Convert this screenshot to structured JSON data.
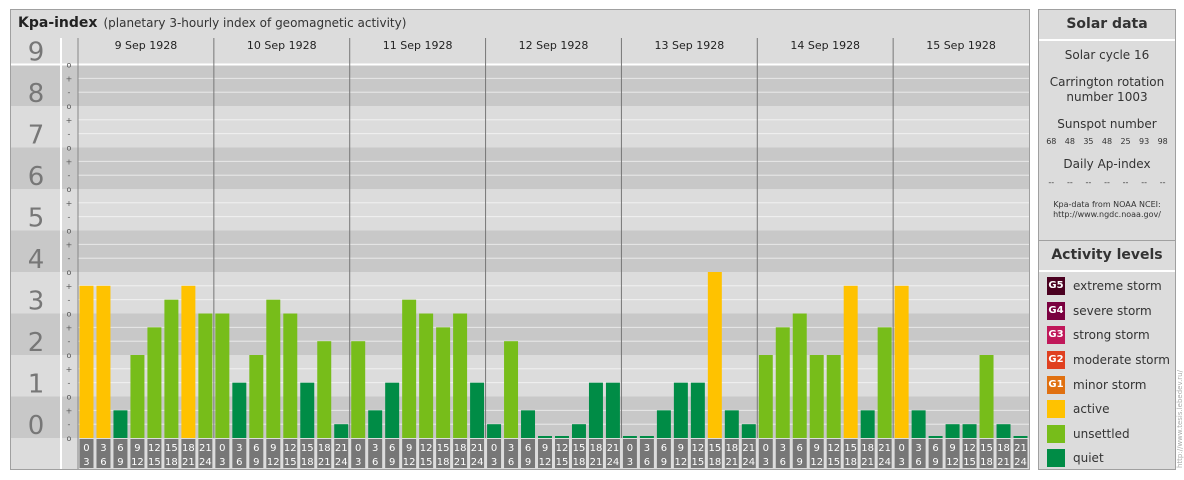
{
  "header": {
    "title": "Kpa-index",
    "subtitle": "(planetary 3-hourly index of geomagnetic activity)"
  },
  "chart_data": {
    "type": "bar",
    "title": "Kpa-index",
    "subtitle": "(planetary 3-hourly index of geomagnetic activity)",
    "ylim": [
      0,
      9
    ],
    "y_ticks": [
      "0",
      "1",
      "2",
      "3",
      "4",
      "5",
      "6",
      "7",
      "8",
      "9"
    ],
    "sub_tick_labels": [
      "+",
      "o",
      "-"
    ],
    "days": [
      "9 Sep 1928",
      "10 Sep 1928",
      "11 Sep 1928",
      "12 Sep 1928",
      "13 Sep 1928",
      "14 Sep 1928",
      "15 Sep 1928"
    ],
    "interval_labels": [
      [
        "0",
        "3"
      ],
      [
        "3",
        "6"
      ],
      [
        "6",
        "9"
      ],
      [
        "9",
        "12"
      ],
      [
        "12",
        "15"
      ],
      [
        "15",
        "18"
      ],
      [
        "18",
        "21"
      ],
      [
        "21",
        "24"
      ]
    ],
    "values": [
      [
        3.667,
        3.667,
        0.667,
        2.0,
        2.667,
        3.333,
        3.667,
        3.0
      ],
      [
        3.0,
        1.333,
        2.0,
        3.333,
        3.0,
        1.333,
        2.333,
        0.333
      ],
      [
        2.333,
        0.667,
        1.333,
        3.333,
        3.0,
        2.667,
        3.0,
        1.333
      ],
      [
        0.333,
        2.333,
        0.667,
        0.0,
        0.0,
        0.333,
        1.333,
        1.333
      ],
      [
        0.0,
        0.0,
        0.667,
        1.333,
        1.333,
        4.0,
        0.667,
        0.333
      ],
      [
        2.0,
        2.667,
        3.0,
        2.0,
        2.0,
        3.667,
        0.667,
        2.667
      ],
      [
        3.667,
        0.667,
        0.0,
        0.333,
        0.333,
        2.0,
        0.333,
        0.0
      ]
    ],
    "colors": {
      "quiet": "#008c46",
      "unsettled": "#77bd1a",
      "active": "#ffc200"
    },
    "thresholds": {
      "unsettled_from": 2.0,
      "active_from": 3.5
    }
  },
  "solar": {
    "title": "Solar data",
    "cycle": "Solar cycle 16",
    "carrington_line1": "Carrington rotation",
    "carrington_line2": "number 1003",
    "sunspot_label": "Sunspot number",
    "sunspots": [
      "68",
      "48",
      "35",
      "48",
      "25",
      "93",
      "98"
    ],
    "ap_label": "Daily Ap-index",
    "ap_values": [
      "--",
      "--",
      "--",
      "--",
      "--",
      "--",
      "--"
    ],
    "source_line1": "Kpa-data from NOAA NCEI:",
    "source_line2": "http://www.ngdc.noaa.gov/"
  },
  "activity": {
    "title": "Activity levels",
    "levels": [
      {
        "badge": "G5",
        "label": "extreme storm",
        "color": "#4a0020"
      },
      {
        "badge": "G4",
        "label": "severe storm",
        "color": "#7a0040"
      },
      {
        "badge": "G3",
        "label": "strong storm",
        "color": "#c0185a"
      },
      {
        "badge": "G2",
        "label": "moderate storm",
        "color": "#e04020"
      },
      {
        "badge": "G1",
        "label": "minor storm",
        "color": "#e07010"
      },
      {
        "badge": "",
        "label": "active",
        "color": "#ffc200"
      },
      {
        "badge": "",
        "label": "unsettled",
        "color": "#77bd1a"
      },
      {
        "badge": "",
        "label": "quiet",
        "color": "#008c46"
      }
    ]
  },
  "watermark": "http://www.tesis.lebedev.ru/"
}
